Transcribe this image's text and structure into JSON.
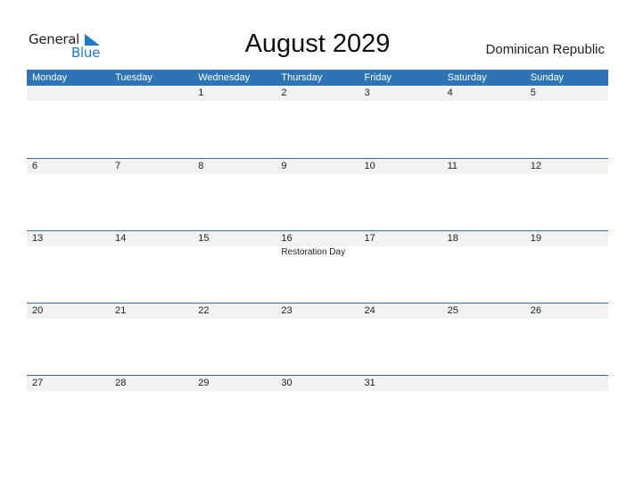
{
  "logo": {
    "word1": "General",
    "word2": "Blue",
    "accent_color": "#1f7bc6"
  },
  "header": {
    "title": "August 2029",
    "country": "Dominican Republic"
  },
  "calendar": {
    "header_color": "#2e74b5",
    "weekdays": [
      "Monday",
      "Tuesday",
      "Wednesday",
      "Thursday",
      "Friday",
      "Saturday",
      "Sunday"
    ],
    "weeks": [
      {
        "days": [
          "",
          "",
          "1",
          "2",
          "3",
          "4",
          "5"
        ],
        "events": [
          "",
          "",
          "",
          "",
          "",
          "",
          ""
        ]
      },
      {
        "days": [
          "6",
          "7",
          "8",
          "9",
          "10",
          "11",
          "12"
        ],
        "events": [
          "",
          "",
          "",
          "",
          "",
          "",
          ""
        ]
      },
      {
        "days": [
          "13",
          "14",
          "15",
          "16",
          "17",
          "18",
          "19"
        ],
        "events": [
          "",
          "",
          "",
          "Restoration Day",
          "",
          "",
          ""
        ]
      },
      {
        "days": [
          "20",
          "21",
          "22",
          "23",
          "24",
          "25",
          "26"
        ],
        "events": [
          "",
          "",
          "",
          "",
          "",
          "",
          ""
        ]
      },
      {
        "days": [
          "27",
          "28",
          "29",
          "30",
          "31",
          "",
          ""
        ],
        "events": [
          "",
          "",
          "",
          "",
          "",
          "",
          ""
        ]
      }
    ]
  }
}
